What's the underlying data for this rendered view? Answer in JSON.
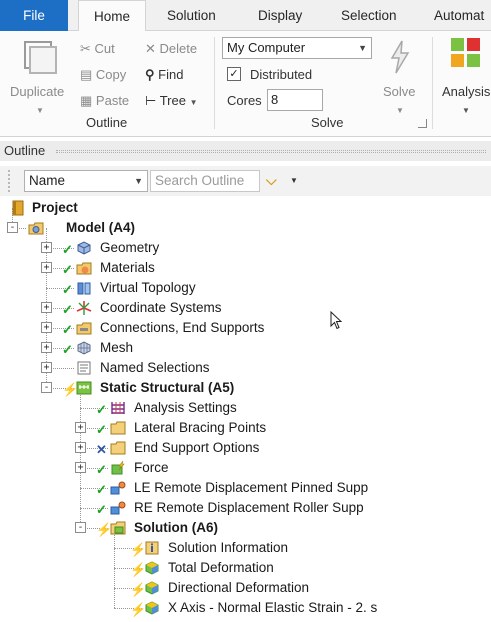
{
  "tabs": [
    {
      "label": "File",
      "kind": "file"
    },
    {
      "label": "Home",
      "kind": "active"
    },
    {
      "label": "Solution",
      "kind": "normal"
    },
    {
      "label": "Display",
      "kind": "normal"
    },
    {
      "label": "Selection",
      "kind": "normal"
    },
    {
      "label": "Automat",
      "kind": "normal"
    }
  ],
  "ribbon": {
    "duplicate": "Duplicate",
    "cut": "Cut",
    "copy": "Copy",
    "paste": "Paste",
    "delete": "Delete",
    "find": "Find",
    "tree": "Tree",
    "outline_group": "Outline",
    "machine": "My Computer",
    "distributed": "Distributed",
    "distributed_checked": true,
    "cores_label": "Cores",
    "cores_value": "8",
    "solve": "Solve",
    "solve_group": "Solve",
    "analysis": "Analysis"
  },
  "outline": {
    "title": "Outline",
    "name_filter": "Name",
    "search_placeholder": "Search Outline"
  },
  "tree": [
    {
      "label": "Project",
      "level": 0,
      "icon": "project-icon",
      "bold": true,
      "toggle": "",
      "status": ""
    },
    {
      "label": "Model (A4)",
      "level": 1,
      "icon": "model-icon",
      "bold": true,
      "toggle": "-",
      "status": ""
    },
    {
      "label": "Geometry",
      "level": 2,
      "icon": "geometry-icon",
      "bold": false,
      "toggle": "+",
      "status": "ok"
    },
    {
      "label": "Materials",
      "level": 2,
      "icon": "materials-icon",
      "bold": false,
      "toggle": "+",
      "status": "ok"
    },
    {
      "label": "Virtual Topology",
      "level": 2,
      "icon": "virtual-topology-icon",
      "bold": false,
      "toggle": "",
      "status": "ok"
    },
    {
      "label": "Coordinate Systems",
      "level": 2,
      "icon": "coordinate-systems-icon",
      "bold": false,
      "toggle": "+",
      "status": "ok"
    },
    {
      "label": "Connections, End Supports",
      "level": 2,
      "icon": "connections-icon",
      "bold": false,
      "toggle": "+",
      "status": "ok"
    },
    {
      "label": "Mesh",
      "level": 2,
      "icon": "mesh-icon",
      "bold": false,
      "toggle": "+",
      "status": "ok"
    },
    {
      "label": "Named Selections",
      "level": 2,
      "icon": "named-selections-icon",
      "bold": false,
      "toggle": "+",
      "status": ""
    },
    {
      "label": "Static Structural (A5)",
      "level": 2,
      "icon": "static-structural-icon",
      "bold": true,
      "toggle": "-",
      "status": "bolt"
    },
    {
      "label": "Analysis Settings",
      "level": 3,
      "icon": "analysis-settings-icon",
      "bold": false,
      "toggle": "",
      "status": "ok"
    },
    {
      "label": "Lateral Bracing Points",
      "level": 3,
      "icon": "folder-icon",
      "bold": false,
      "toggle": "+",
      "status": "ok"
    },
    {
      "label": "End Support Options",
      "level": 3,
      "icon": "folder-icon",
      "bold": false,
      "toggle": "+",
      "status": "x"
    },
    {
      "label": "Force",
      "level": 3,
      "icon": "force-icon",
      "bold": false,
      "toggle": "+",
      "status": "ok"
    },
    {
      "label": "LE Remote Displacement Pinned Supp",
      "level": 3,
      "icon": "remote-displacement-icon",
      "bold": false,
      "toggle": "",
      "status": "ok"
    },
    {
      "label": "RE Remote Displacement Roller Supp",
      "level": 3,
      "icon": "remote-displacement-icon",
      "bold": false,
      "toggle": "",
      "status": "ok"
    },
    {
      "label": "Solution (A6)",
      "level": 3,
      "icon": "solution-icon",
      "bold": true,
      "toggle": "-",
      "status": "bolt"
    },
    {
      "label": "Solution Information",
      "level": 4,
      "icon": "solution-information-icon",
      "bold": false,
      "toggle": "",
      "status": "bolt"
    },
    {
      "label": "Total Deformation",
      "level": 4,
      "icon": "result-icon",
      "bold": false,
      "toggle": "",
      "status": "bolt"
    },
    {
      "label": "Directional Deformation",
      "level": 4,
      "icon": "result-icon",
      "bold": false,
      "toggle": "",
      "status": "bolt"
    },
    {
      "label": "X Axis - Normal Elastic Strain - 2. s",
      "level": 4,
      "icon": "result-icon",
      "bold": false,
      "toggle": "",
      "status": "bolt"
    }
  ]
}
